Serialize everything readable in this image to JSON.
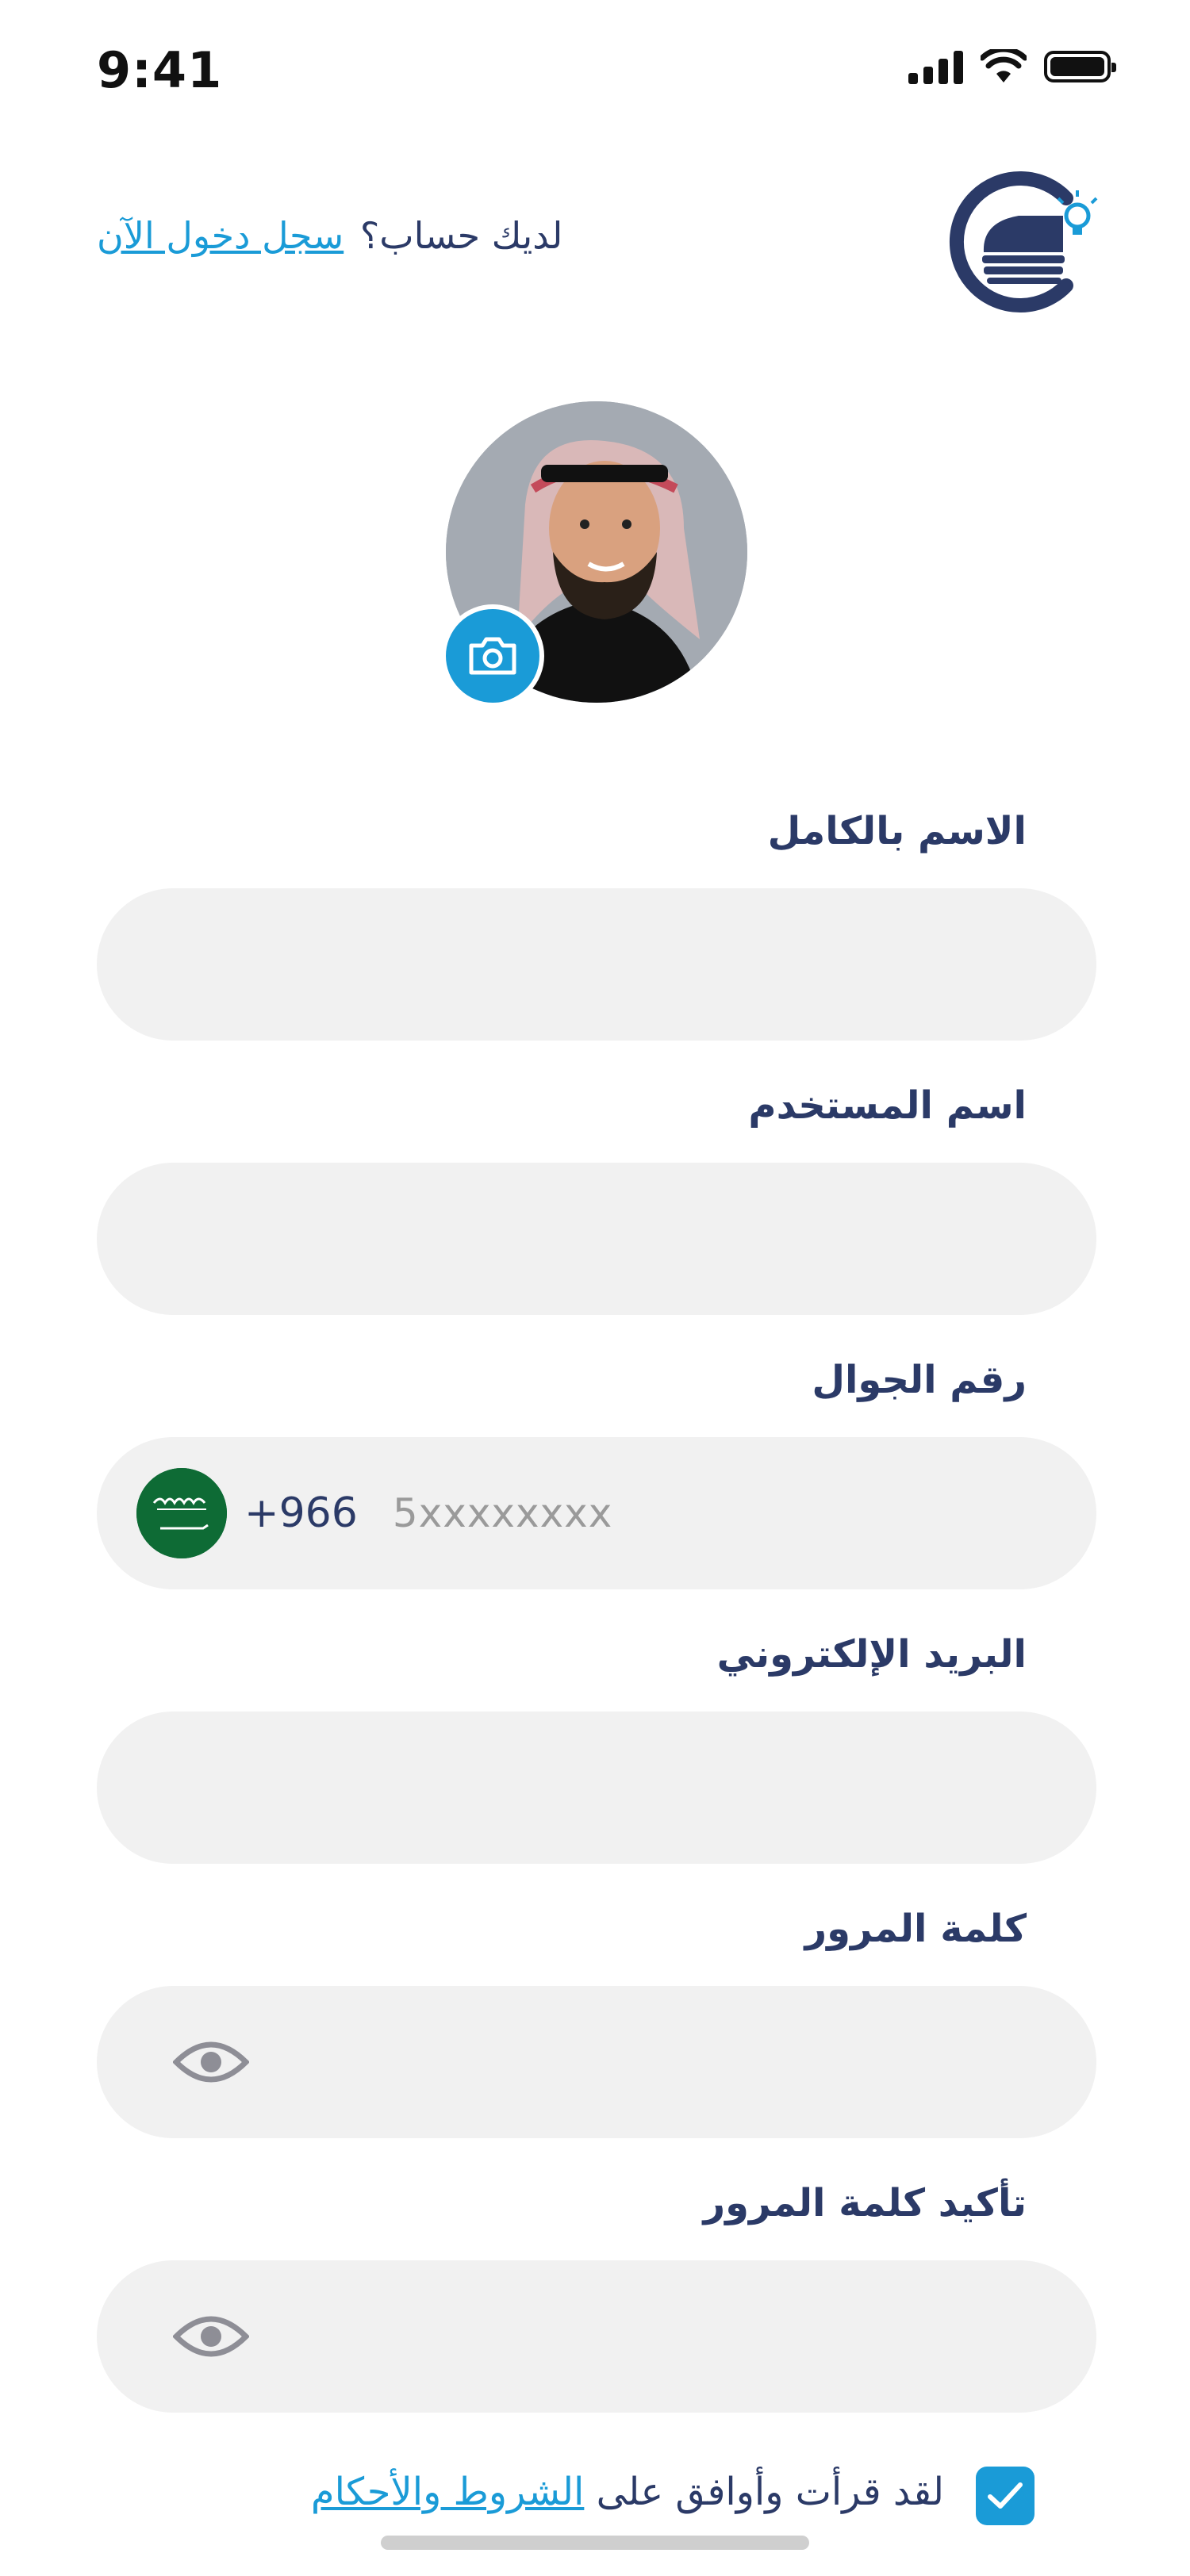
{
  "status_bar": {
    "time": "9:41"
  },
  "header": {
    "login_prompt": "لديك حساب؟",
    "login_link": "سجل دخول الآن"
  },
  "form": {
    "full_name": {
      "label": "الاسم بالكامل",
      "value": ""
    },
    "username": {
      "label": "اسم المستخدم",
      "value": ""
    },
    "phone": {
      "label": "رقم الجوال",
      "country_code": "+966",
      "placeholder": "5xxxxxxxx"
    },
    "email": {
      "label": "البريد الإلكتروني",
      "value": ""
    },
    "password": {
      "label": "كلمة المرور",
      "value": ""
    },
    "confirm_password": {
      "label": "تأكيد كلمة المرور",
      "value": ""
    }
  },
  "terms": {
    "prefix": "لقد قرأت وأوافق على",
    "link": "الشروط والأحكام",
    "checked": true
  },
  "icons": {
    "logo": "app-logo-icon",
    "camera": "camera-icon",
    "flag": "saudi-flag-icon",
    "eye": "eye-icon",
    "check": "check-icon"
  },
  "colors": {
    "primary_navy": "#2b3a67",
    "accent_blue": "#1a9bd7",
    "field_bg": "#f1f1f1",
    "flag_green": "#0e6b35"
  }
}
